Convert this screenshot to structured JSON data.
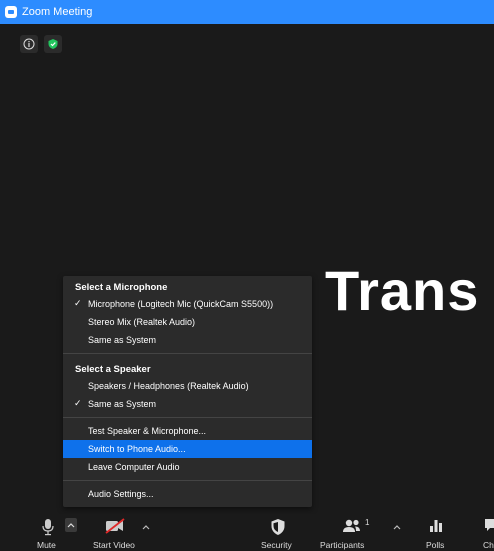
{
  "window": {
    "title": "Zoom Meeting"
  },
  "video": {
    "share_text": "Trans"
  },
  "audio_menu": {
    "microphone_header": "Select a Microphone",
    "microphones": [
      {
        "label": "Microphone (Logitech Mic (QuickCam S5500))",
        "checked": true
      },
      {
        "label": "Stereo Mix (Realtek Audio)",
        "checked": false
      },
      {
        "label": "Same as System",
        "checked": false
      }
    ],
    "speaker_header": "Select a Speaker",
    "speakers": [
      {
        "label": "Speakers / Headphones (Realtek Audio)",
        "checked": false
      },
      {
        "label": "Same as System",
        "checked": true
      }
    ],
    "actions": [
      {
        "label": "Test Speaker & Microphone...",
        "highlighted": false
      },
      {
        "label": "Switch to Phone Audio...",
        "highlighted": true
      },
      {
        "label": "Leave Computer Audio",
        "highlighted": false
      }
    ],
    "settings": "Audio Settings..."
  },
  "toolbar": {
    "mute": "Mute",
    "start_video": "Start Video",
    "security": "Security",
    "participants": "Participants",
    "participants_count": "1",
    "polls": "Polls",
    "chat_partial": "Ch"
  },
  "colors": {
    "titlebar": "#2d8cff",
    "highlight": "#0e71eb",
    "shield_green": "#22c55e",
    "video_off_red": "#e02828"
  }
}
